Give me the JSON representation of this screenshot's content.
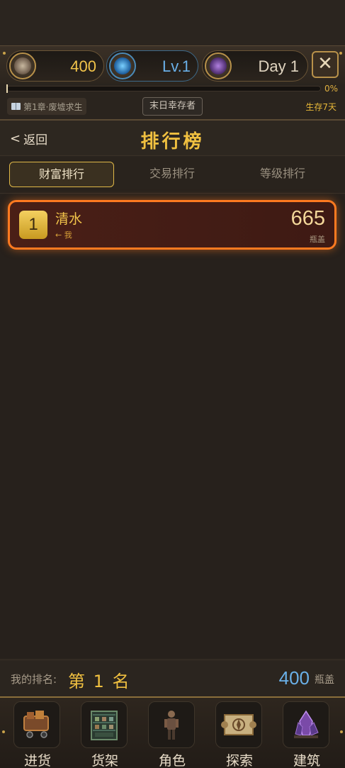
{
  "resources": {
    "caps_value": "400",
    "level_value": "Lv.1",
    "day_value": "Day 1",
    "close_label": "✕"
  },
  "progress": {
    "percent_label": "0%",
    "fraction": 0.0
  },
  "chapter": {
    "tag": "第1章·废墟求生",
    "title": "末日幸存者",
    "survive": "生存7天"
  },
  "header": {
    "back_label": "返回",
    "title": "排行榜"
  },
  "tabs": [
    {
      "label": "财富排行",
      "active": true
    },
    {
      "label": "交易排行",
      "active": false
    },
    {
      "label": "等级排行",
      "active": false
    }
  ],
  "rows": [
    {
      "rank": "1",
      "name": "清水",
      "tag": "← 我",
      "score": "665",
      "unit": "瓶盖"
    }
  ],
  "my_rank": {
    "label": "我的排名:",
    "place": "第 1 名",
    "caps": "400",
    "caps_unit": "瓶盖"
  },
  "nav": [
    {
      "label": "进货",
      "icon": "cart-icon"
    },
    {
      "label": "货架",
      "icon": "shelf-icon"
    },
    {
      "label": "角色",
      "icon": "character-icon"
    },
    {
      "label": "探索",
      "icon": "map-icon"
    },
    {
      "label": "建筑",
      "icon": "crystal-icon"
    }
  ],
  "colors": {
    "accent_gold": "#f0c040",
    "highlight_orange": "#ff7a20",
    "level_blue": "#6ab0e8"
  }
}
